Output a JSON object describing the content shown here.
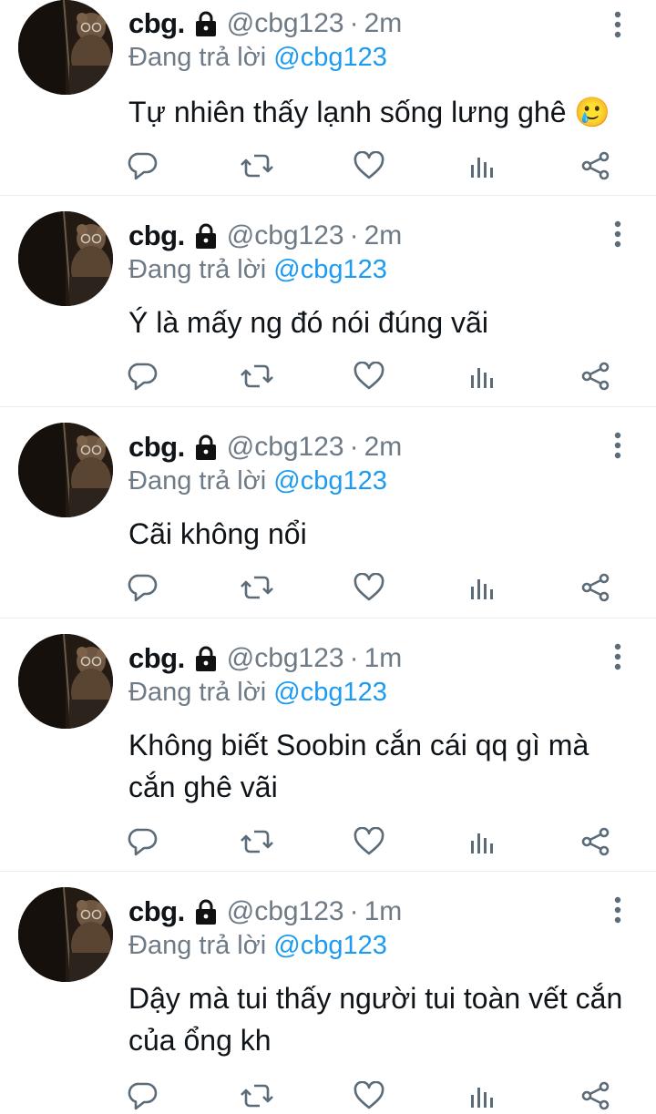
{
  "user": {
    "name": "cbg.",
    "handle": "@cbg123",
    "separator": "·",
    "reply_prefix": "Đang trả lời",
    "reply_handle": "@cbg123"
  },
  "tweets": [
    {
      "time": "2m",
      "text": "Tự nhiên thấy lạnh sống lưng ghê",
      "emoji": "🥲"
    },
    {
      "time": "2m",
      "text": "Ý là mấy ng đó nói đúng vãi",
      "emoji": ""
    },
    {
      "time": "2m",
      "text": "Cãi không nổi",
      "emoji": ""
    },
    {
      "time": "1m",
      "text": "Không biết Soobin cắn cái qq gì mà cắn ghê vãi",
      "emoji": ""
    },
    {
      "time": "1m",
      "text": "Dậy mà tui thấy người tui toàn vết cắn của ổng kh",
      "emoji": ""
    }
  ],
  "icons": {
    "lock": "lock-icon",
    "more": "more-vertical-icon",
    "reply": "reply-icon",
    "retweet": "retweet-icon",
    "like": "heart-icon",
    "views": "analytics-icon",
    "share": "share-icon"
  },
  "colors": {
    "accent": "#1d9bf0",
    "secondary_text": "#6e7b86",
    "icon": "#5b6b78",
    "divider": "#e6ecf0"
  }
}
